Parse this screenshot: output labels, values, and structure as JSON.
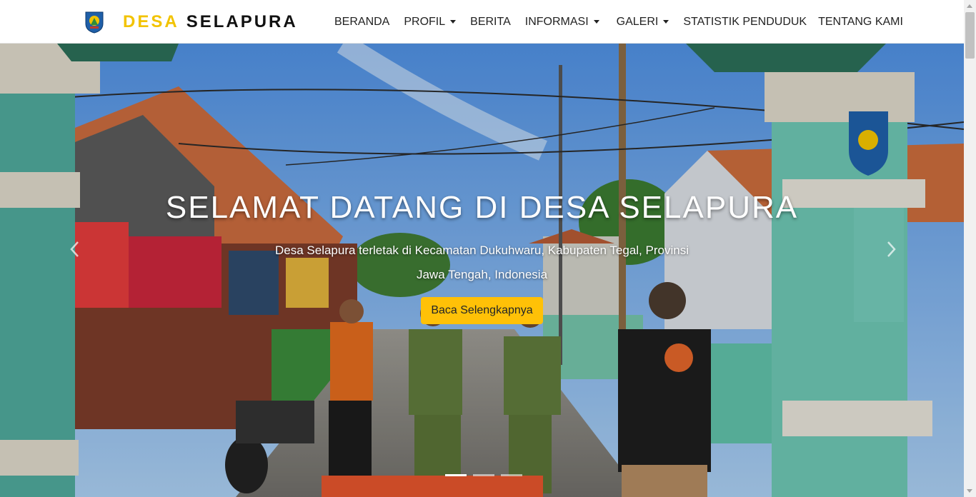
{
  "brand": {
    "name_part1": "DESA",
    "name_part2": "SELAPURA",
    "logo_icon": "village-emblem-icon"
  },
  "nav": {
    "items": [
      {
        "label": "BERANDA",
        "dropdown": false
      },
      {
        "label": "PROFIL",
        "dropdown": true
      },
      {
        "label": "BERITA",
        "dropdown": false
      },
      {
        "label": "INFORMASI",
        "dropdown": true
      },
      {
        "label": "GALERI",
        "dropdown": true
      },
      {
        "label": "STATISTIK PENDUDUK",
        "dropdown": false
      },
      {
        "label": "TENTANG KAMI",
        "dropdown": false
      }
    ]
  },
  "hero": {
    "title": "SELAMAT DATANG DI DESA SELAPURA",
    "subtitle": "Desa Selapura terletak di Kecamatan Dukuhwaru, Kabupaten Tegal, Provinsi Jawa Tengah, Indonesia",
    "button_label": "Baca Selengkapnya",
    "slide_count": 3,
    "active_slide": 1
  },
  "colors": {
    "accent": "#f2c300",
    "button": "#ffc107",
    "nav_text": "#222222"
  }
}
